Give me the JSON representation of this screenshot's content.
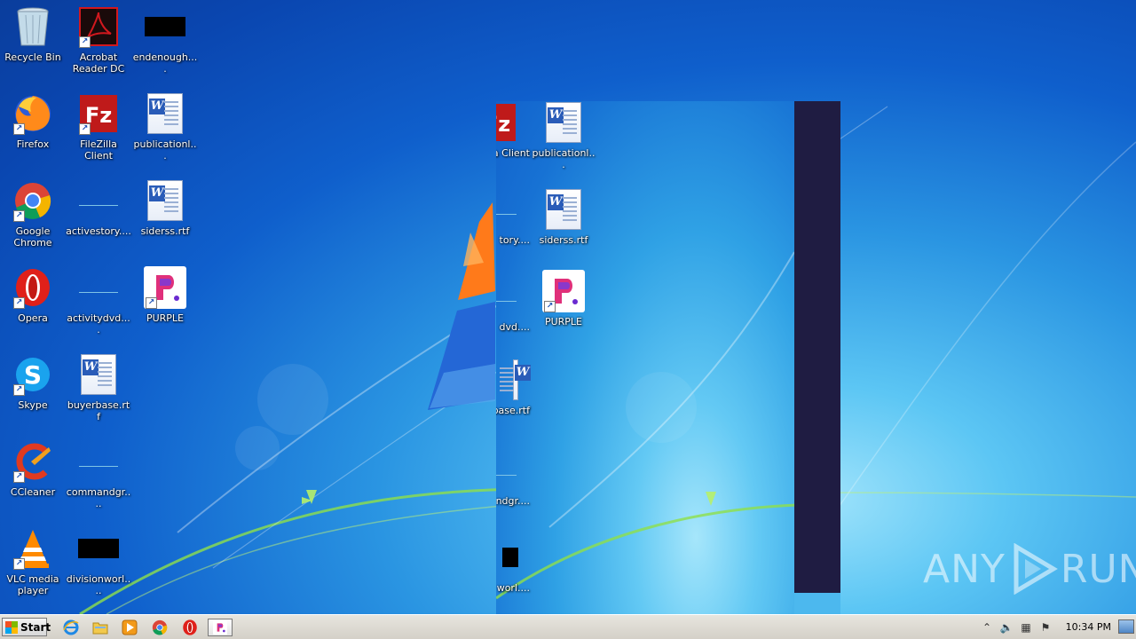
{
  "desktop": {
    "icons": [
      {
        "label": "Recycle Bin"
      },
      {
        "label": "Acrobat Reader DC"
      },
      {
        "label": "endenough...."
      },
      {
        "label": "Firefox"
      },
      {
        "label": "FileZilla Client"
      },
      {
        "label": "publicationl..."
      },
      {
        "label": "Google Chrome"
      },
      {
        "label": "activestory...."
      },
      {
        "label": "siderss.rtf"
      },
      {
        "label": "Opera"
      },
      {
        "label": "activitydvd...."
      },
      {
        "label": "PURPLE"
      },
      {
        "label": "Skype"
      },
      {
        "label": "buyerbase.rtf"
      },
      {
        "label": "CCleaner"
      },
      {
        "label": "commandgr...."
      },
      {
        "label": "VLC media player"
      },
      {
        "label": "divisionworl...."
      }
    ]
  },
  "overlay": {
    "icons": [
      {
        "label": "a Client"
      },
      {
        "label": "publicationl..."
      },
      {
        "label": "tory...."
      },
      {
        "label": "siderss.rtf"
      },
      {
        "label": "dvd...."
      },
      {
        "label": "PURPLE"
      },
      {
        "label": "base.rtf"
      },
      {
        "label": "ndgr...."
      },
      {
        "label": "worl...."
      }
    ]
  },
  "taskbar": {
    "start_label": "Start",
    "clock": "10:34 PM"
  },
  "watermark": {
    "left": "ANY",
    "right": "RUN"
  },
  "colors": {
    "taskbar": "#d4d0c8",
    "overlay_dark": "#1f1c42"
  }
}
